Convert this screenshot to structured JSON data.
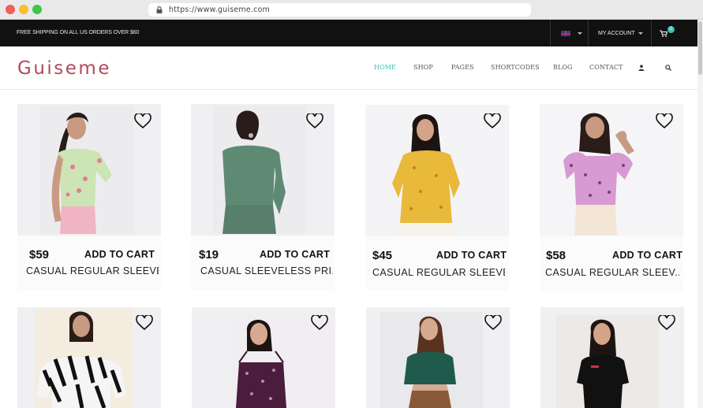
{
  "browser": {
    "url": "https://www.guiseme.com"
  },
  "topbar": {
    "shipping_text": "FREE SHIPPING ON ALL US ORDERS OVER $60",
    "account_label": "MY ACCOUNT",
    "cart_count": "0"
  },
  "header": {
    "logo": "Guiseme",
    "nav": [
      "HOME",
      "SHOP",
      "PAGES",
      "SHORTCODES",
      "BLOG",
      "CONTACT"
    ]
  },
  "products": [
    {
      "price": "$59",
      "add_label": "ADD TO CART",
      "name": "CASUAL REGULAR SLEEVE..."
    },
    {
      "price": "$19",
      "add_label": "ADD TO CART",
      "name": "CASUAL SLEEVELESS PRI..."
    },
    {
      "price": "$45",
      "add_label": "ADD TO CART",
      "name": "CASUAL REGULAR SLEEVE..."
    },
    {
      "price": "$58",
      "add_label": "ADD TO CART",
      "name": "CASUAL REGULAR SLEEV..."
    }
  ],
  "colors": {
    "accent": "#3cc2b3",
    "brand": "#b14a60",
    "topbar": "#111111"
  }
}
